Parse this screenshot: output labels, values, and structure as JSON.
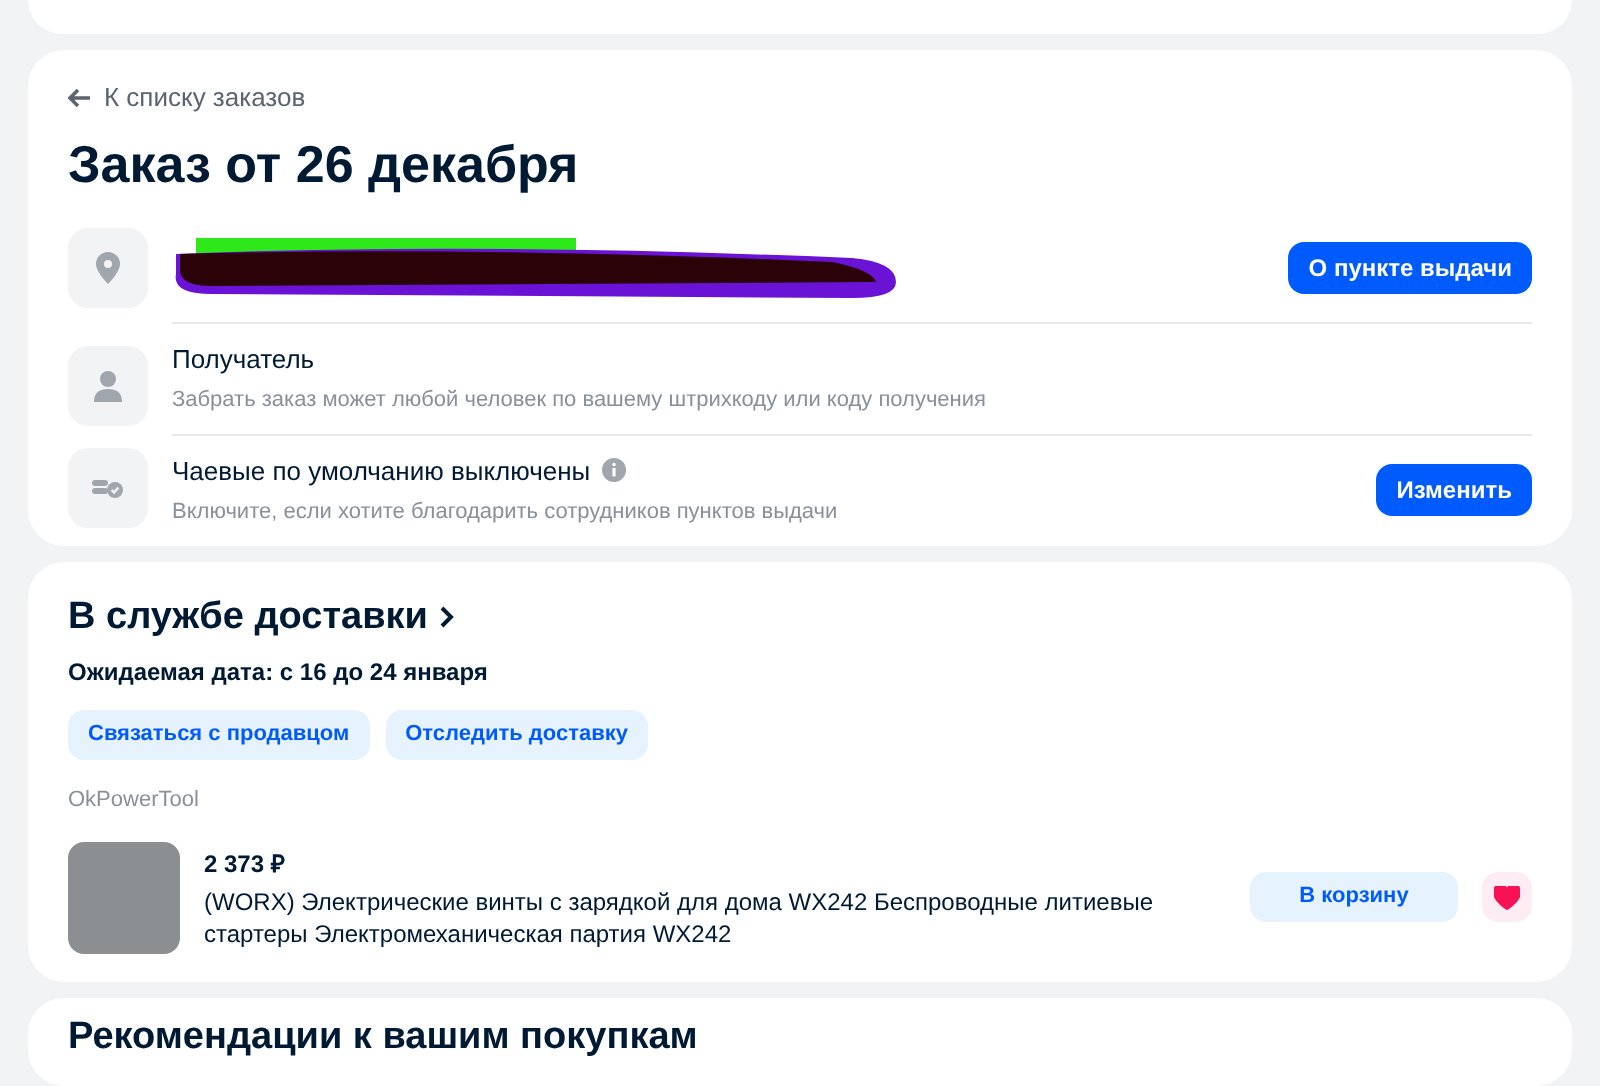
{
  "back_link": "К списку заказов",
  "order_title": "Заказ от 26 декабря",
  "pickup_row": {
    "address_redacted": true,
    "button": "О пункте выдачи"
  },
  "recipient_row": {
    "title": "Получатель",
    "subtitle": "Забрать заказ может любой человек по вашему штрихкоду или коду получения"
  },
  "tips_row": {
    "title": "Чаевые по умолчанию выключены",
    "subtitle": "Включите, если хотите благодарить сотрудников пунктов выдачи",
    "button": "Изменить"
  },
  "delivery": {
    "status": "В службе доставки",
    "expected_date": "Ожидаемая дата: с 16 до 24 января",
    "actions": [
      "Связаться с продавцом",
      "Отследить доставку"
    ],
    "seller": "OkPowerTool",
    "item": {
      "price": "2 373 ₽",
      "name": "(WORX) Электрические винты с зарядкой для дома WX242 Беспроводные литиевые стартеры Электромеханическая партия WX242",
      "cart_button": "В корзину",
      "favorite": true
    }
  },
  "recommendations_title": "Рекомендации к вашим покупкам"
}
